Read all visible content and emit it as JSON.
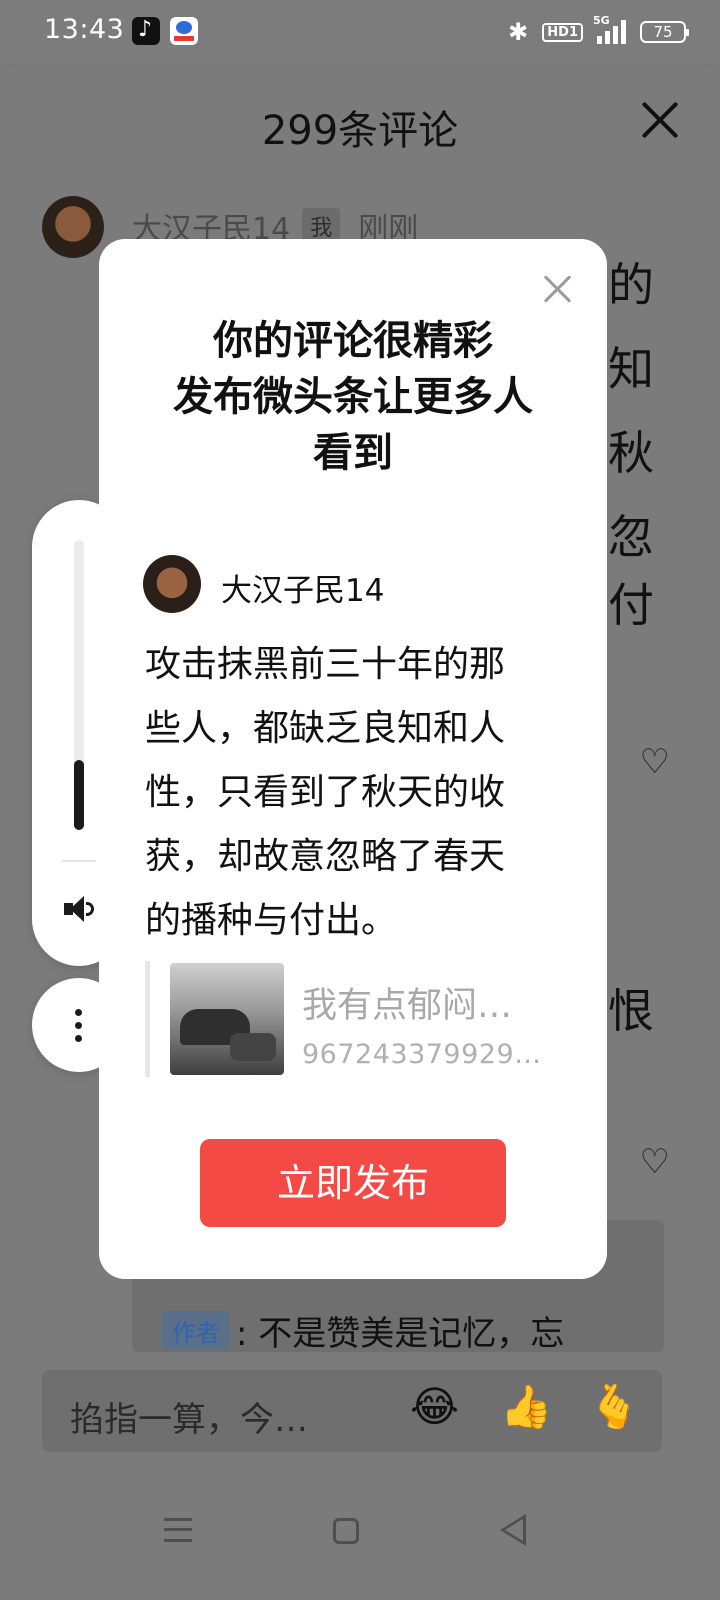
{
  "status_bar": {
    "time": "13:43",
    "hd": "HD1",
    "network": "5G",
    "battery": "75"
  },
  "sheet": {
    "title": "299条评论",
    "comment": {
      "author": "大汉子民14",
      "me_tag": "我",
      "time": "刚刚"
    },
    "edge_chars": [
      "的",
      "知",
      "秋",
      "忽",
      "付",
      "恨"
    ],
    "reply": {
      "tag": "作者",
      "text": ": 不是赞美是记忆，忘"
    },
    "input": {
      "text": "掐指一算，今…"
    },
    "emojis": [
      "😂",
      "👍",
      "🫰"
    ]
  },
  "modal": {
    "title_lines": [
      "你的评论很精彩",
      "发布微头条让更多人",
      "看到"
    ],
    "author": "大汉子民14",
    "text_lines": [
      "攻击抹黑前三十年的那",
      "些人，都缺乏良知和人",
      "性，只看到了秋天的收",
      "获，却故意忽略了春天",
      "的播种与付出。"
    ],
    "quote": {
      "title": "我有点郁闷…",
      "id": "967243379929…"
    },
    "publish_label": "立即发布"
  },
  "volume": {
    "level_percent": 24
  },
  "icons": {
    "close": "close-icon",
    "heart": "broken-heart-icon",
    "speaker": "speaker-icon",
    "more": "more-vertical-icon",
    "bluetooth": "bluetooth-icon"
  },
  "colors": {
    "accent": "#f34a45",
    "author_tag": "#2f64b5"
  }
}
